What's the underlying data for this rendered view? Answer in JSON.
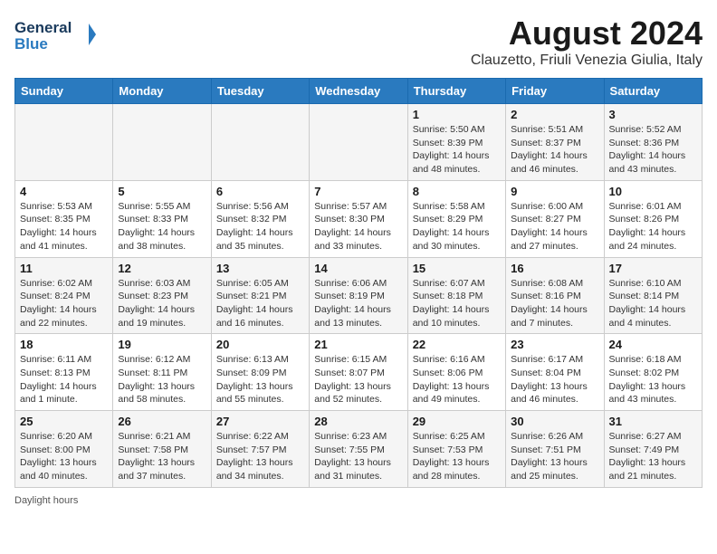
{
  "header": {
    "logo_line1": "General",
    "logo_line2": "Blue",
    "month": "August 2024",
    "location": "Clauzetto, Friuli Venezia Giulia, Italy"
  },
  "days_of_week": [
    "Sunday",
    "Monday",
    "Tuesday",
    "Wednesday",
    "Thursday",
    "Friday",
    "Saturday"
  ],
  "weeks": [
    [
      {
        "day": "",
        "info": ""
      },
      {
        "day": "",
        "info": ""
      },
      {
        "day": "",
        "info": ""
      },
      {
        "day": "",
        "info": ""
      },
      {
        "day": "1",
        "info": "Sunrise: 5:50 AM\nSunset: 8:39 PM\nDaylight: 14 hours and 48 minutes."
      },
      {
        "day": "2",
        "info": "Sunrise: 5:51 AM\nSunset: 8:37 PM\nDaylight: 14 hours and 46 minutes."
      },
      {
        "day": "3",
        "info": "Sunrise: 5:52 AM\nSunset: 8:36 PM\nDaylight: 14 hours and 43 minutes."
      }
    ],
    [
      {
        "day": "4",
        "info": "Sunrise: 5:53 AM\nSunset: 8:35 PM\nDaylight: 14 hours and 41 minutes."
      },
      {
        "day": "5",
        "info": "Sunrise: 5:55 AM\nSunset: 8:33 PM\nDaylight: 14 hours and 38 minutes."
      },
      {
        "day": "6",
        "info": "Sunrise: 5:56 AM\nSunset: 8:32 PM\nDaylight: 14 hours and 35 minutes."
      },
      {
        "day": "7",
        "info": "Sunrise: 5:57 AM\nSunset: 8:30 PM\nDaylight: 14 hours and 33 minutes."
      },
      {
        "day": "8",
        "info": "Sunrise: 5:58 AM\nSunset: 8:29 PM\nDaylight: 14 hours and 30 minutes."
      },
      {
        "day": "9",
        "info": "Sunrise: 6:00 AM\nSunset: 8:27 PM\nDaylight: 14 hours and 27 minutes."
      },
      {
        "day": "10",
        "info": "Sunrise: 6:01 AM\nSunset: 8:26 PM\nDaylight: 14 hours and 24 minutes."
      }
    ],
    [
      {
        "day": "11",
        "info": "Sunrise: 6:02 AM\nSunset: 8:24 PM\nDaylight: 14 hours and 22 minutes."
      },
      {
        "day": "12",
        "info": "Sunrise: 6:03 AM\nSunset: 8:23 PM\nDaylight: 14 hours and 19 minutes."
      },
      {
        "day": "13",
        "info": "Sunrise: 6:05 AM\nSunset: 8:21 PM\nDaylight: 14 hours and 16 minutes."
      },
      {
        "day": "14",
        "info": "Sunrise: 6:06 AM\nSunset: 8:19 PM\nDaylight: 14 hours and 13 minutes."
      },
      {
        "day": "15",
        "info": "Sunrise: 6:07 AM\nSunset: 8:18 PM\nDaylight: 14 hours and 10 minutes."
      },
      {
        "day": "16",
        "info": "Sunrise: 6:08 AM\nSunset: 8:16 PM\nDaylight: 14 hours and 7 minutes."
      },
      {
        "day": "17",
        "info": "Sunrise: 6:10 AM\nSunset: 8:14 PM\nDaylight: 14 hours and 4 minutes."
      }
    ],
    [
      {
        "day": "18",
        "info": "Sunrise: 6:11 AM\nSunset: 8:13 PM\nDaylight: 14 hours and 1 minute."
      },
      {
        "day": "19",
        "info": "Sunrise: 6:12 AM\nSunset: 8:11 PM\nDaylight: 13 hours and 58 minutes."
      },
      {
        "day": "20",
        "info": "Sunrise: 6:13 AM\nSunset: 8:09 PM\nDaylight: 13 hours and 55 minutes."
      },
      {
        "day": "21",
        "info": "Sunrise: 6:15 AM\nSunset: 8:07 PM\nDaylight: 13 hours and 52 minutes."
      },
      {
        "day": "22",
        "info": "Sunrise: 6:16 AM\nSunset: 8:06 PM\nDaylight: 13 hours and 49 minutes."
      },
      {
        "day": "23",
        "info": "Sunrise: 6:17 AM\nSunset: 8:04 PM\nDaylight: 13 hours and 46 minutes."
      },
      {
        "day": "24",
        "info": "Sunrise: 6:18 AM\nSunset: 8:02 PM\nDaylight: 13 hours and 43 minutes."
      }
    ],
    [
      {
        "day": "25",
        "info": "Sunrise: 6:20 AM\nSunset: 8:00 PM\nDaylight: 13 hours and 40 minutes."
      },
      {
        "day": "26",
        "info": "Sunrise: 6:21 AM\nSunset: 7:58 PM\nDaylight: 13 hours and 37 minutes."
      },
      {
        "day": "27",
        "info": "Sunrise: 6:22 AM\nSunset: 7:57 PM\nDaylight: 13 hours and 34 minutes."
      },
      {
        "day": "28",
        "info": "Sunrise: 6:23 AM\nSunset: 7:55 PM\nDaylight: 13 hours and 31 minutes."
      },
      {
        "day": "29",
        "info": "Sunrise: 6:25 AM\nSunset: 7:53 PM\nDaylight: 13 hours and 28 minutes."
      },
      {
        "day": "30",
        "info": "Sunrise: 6:26 AM\nSunset: 7:51 PM\nDaylight: 13 hours and 25 minutes."
      },
      {
        "day": "31",
        "info": "Sunrise: 6:27 AM\nSunset: 7:49 PM\nDaylight: 13 hours and 21 minutes."
      }
    ]
  ],
  "footer": "Daylight hours"
}
